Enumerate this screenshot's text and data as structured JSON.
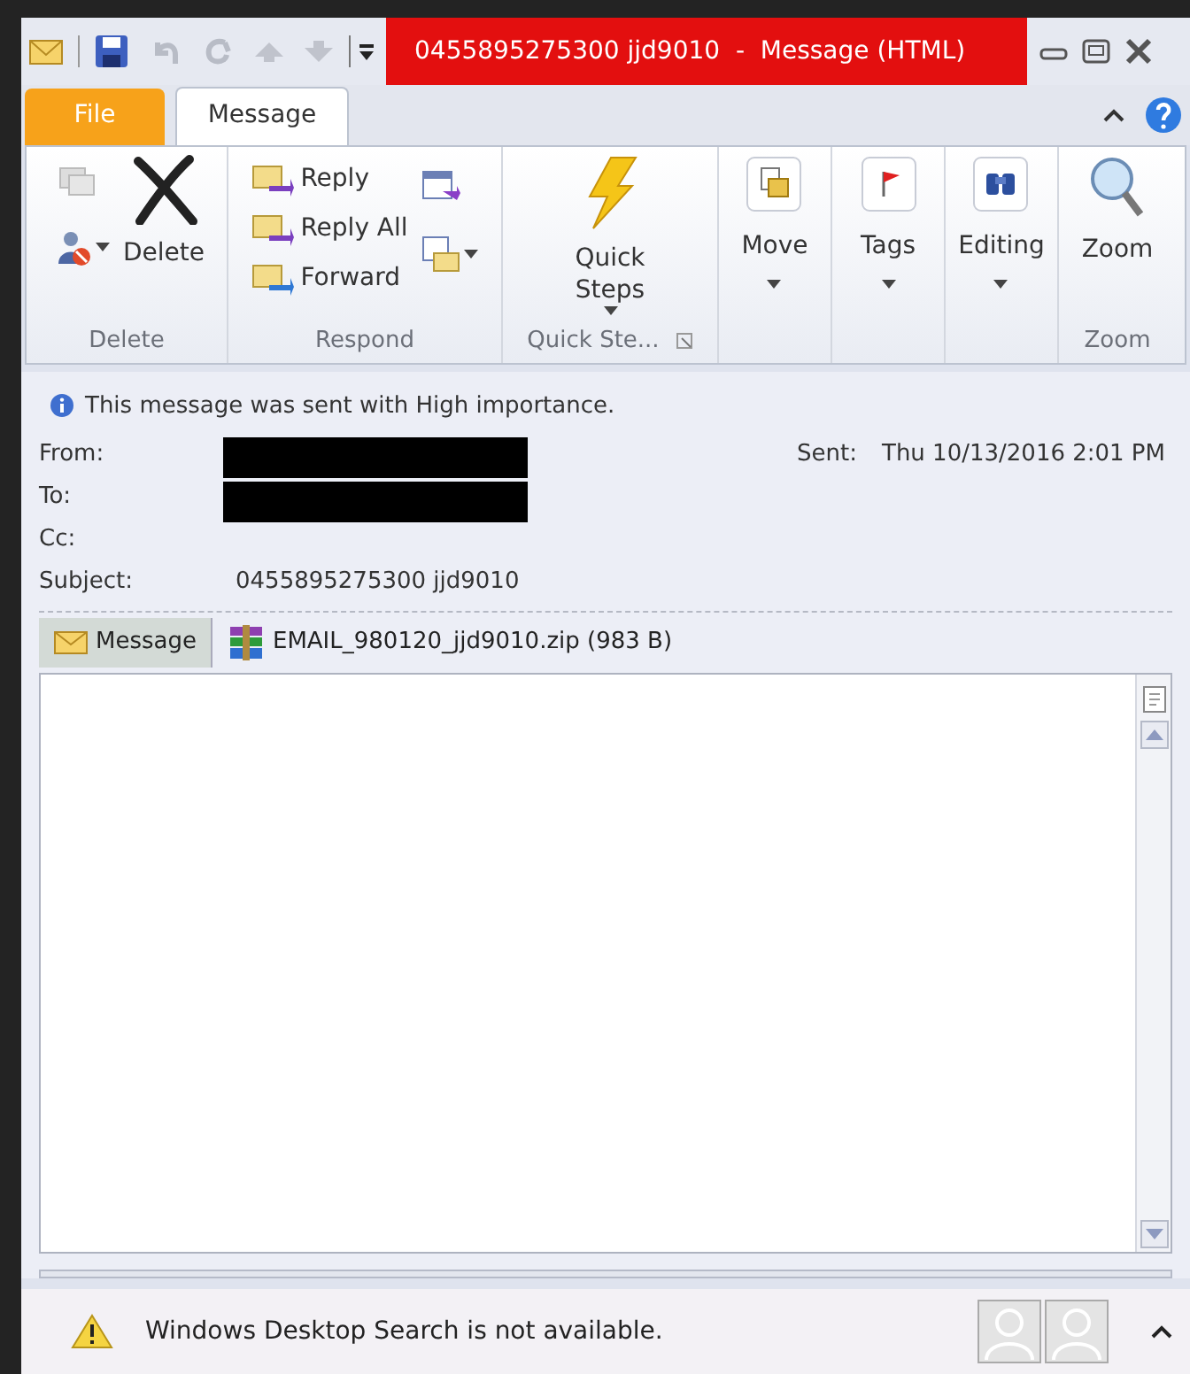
{
  "window": {
    "title": "0455895275300 jjd9010  -  Message (HTML)"
  },
  "tabs": [
    {
      "label": "File",
      "kind": "file",
      "selected": false
    },
    {
      "label": "Message",
      "kind": "tab",
      "selected": true
    }
  ],
  "ribbon": {
    "groups": [
      {
        "kind": "delete",
        "label": "Delete",
        "buttons": [
          "Delete"
        ]
      },
      {
        "kind": "respond",
        "label": "Respond",
        "buttons": [
          "Reply",
          "Reply All",
          "Forward"
        ]
      },
      {
        "kind": "quick",
        "label": "Quick Ste...",
        "buttons": [
          "Quick Steps"
        ]
      },
      {
        "kind": "move",
        "buttons": [
          "Move"
        ]
      },
      {
        "kind": "tags",
        "buttons": [
          "Tags"
        ]
      },
      {
        "kind": "editing",
        "buttons": [
          "Editing"
        ]
      },
      {
        "kind": "zoom",
        "label": "Zoom",
        "buttons": [
          "Zoom"
        ]
      }
    ]
  },
  "infobar": "This message was sent with High importance.",
  "header": {
    "fields": [
      {
        "label": "From:",
        "redacted": true
      },
      {
        "label": "To:",
        "redacted": true
      },
      {
        "label": "Cc:"
      },
      {
        "label": "Subject:",
        "value": "0455895275300 jjd9010"
      }
    ],
    "sent_label": "Sent:",
    "sent_value": "Thu 10/13/2016 2:01 PM"
  },
  "attachments": [
    {
      "kind": "message",
      "label": "Message",
      "selected": true
    },
    {
      "kind": "zip",
      "label": "EMAIL_980120_jjd9010.zip (983 B)",
      "selected": false
    }
  ],
  "status_bar": {
    "text": "Windows Desktop Search is not available."
  }
}
